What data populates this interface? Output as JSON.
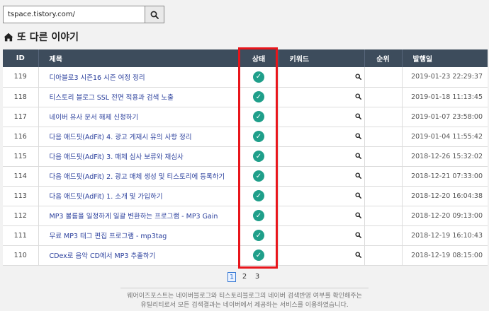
{
  "search": {
    "value": "tspace.tistory.com/"
  },
  "heading": {
    "title": "또 다른 이야기"
  },
  "table": {
    "headers": {
      "id": "ID",
      "title": "제목",
      "status": "상태",
      "keyword": "키워드",
      "rank": "순위",
      "date": "발행일"
    },
    "rows": [
      {
        "id": "119",
        "title": "디아블로3 시즌16 시즌 여정 정리",
        "date": "2019-01-23 22:29:37"
      },
      {
        "id": "118",
        "title": "티스토리 블로그 SSL 전면 적용과 검색 노출",
        "date": "2019-01-18 11:13:45"
      },
      {
        "id": "117",
        "title": "네이버 유사 문서 해제 신청하기",
        "date": "2019-01-07 23:58:00"
      },
      {
        "id": "116",
        "title": "다음 애드핏(AdFit) 4. 광고 게재시 유의 사항 정리",
        "date": "2019-01-04 11:55:42"
      },
      {
        "id": "115",
        "title": "다음 애드핏(AdFit) 3. 매체 심사 보류와 재심사",
        "date": "2018-12-26 15:32:02"
      },
      {
        "id": "114",
        "title": "다음 애드핏(AdFit) 2. 광고 매체 생성 및 티스토리에 등록하기",
        "date": "2018-12-21 07:33:00"
      },
      {
        "id": "113",
        "title": "다음 애드핏(AdFit) 1. 소개 및 가입하기",
        "date": "2018-12-20 16:04:38"
      },
      {
        "id": "112",
        "title": "MP3 볼륨을 일정하게 일괄 변환하는 프로그램 - MP3 Gain",
        "date": "2018-12-20 09:13:00"
      },
      {
        "id": "111",
        "title": "무료 MP3 태그 편집 프로그램 - mp3tag",
        "date": "2018-12-19 16:10:43"
      },
      {
        "id": "110",
        "title": "CDex로 음악 CD에서 MP3 추출하기",
        "date": "2018-12-19 08:15:00"
      }
    ],
    "status_icon": "check-circle-icon",
    "status_color": "#1f9f8a",
    "keyword_icon": "search-icon"
  },
  "pagination": {
    "pages": [
      "1",
      "2",
      "3"
    ],
    "current": "1"
  },
  "footer": {
    "line1": "웨어이즈포스트는 네이버블로그와 티스토리블로그의 네이버 검색반영 여부를 확인해주는",
    "line2": "유틸리티로서 모든 검색결과는 네이버에서 제공하는 서비스를 이용하였습니다."
  },
  "colors": {
    "header_bg": "#3d4c5c",
    "link": "#2a3f9c",
    "highlight": "#e8151b"
  }
}
